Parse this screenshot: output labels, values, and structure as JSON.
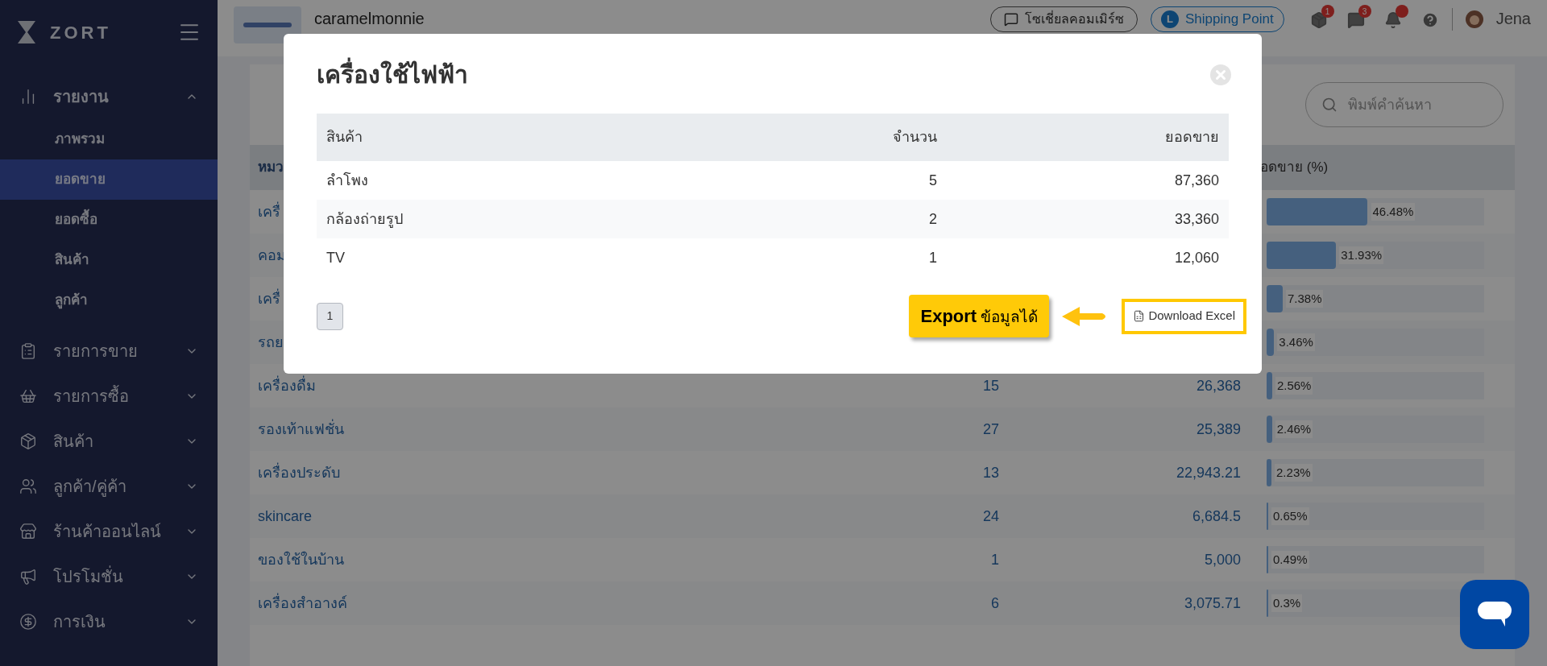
{
  "sidebar": {
    "logo": "ZORT",
    "items": [
      {
        "label": "รายงาน",
        "expanded": true,
        "children": [
          {
            "label": "ภาพรวม",
            "selected": false
          },
          {
            "label": "ยอดขาย",
            "selected": true
          },
          {
            "label": "ยอดซื้อ",
            "selected": false
          },
          {
            "label": "สินค้า",
            "selected": false
          },
          {
            "label": "ลูกค้า",
            "selected": false
          }
        ]
      },
      {
        "label": "รายการขาย",
        "expanded": false
      },
      {
        "label": "รายการซื้อ",
        "expanded": false
      },
      {
        "label": "สินค้า",
        "expanded": false
      },
      {
        "label": "ลูกค้า/คู่ค้า",
        "expanded": false
      },
      {
        "label": "ร้านค้าออนไลน์",
        "expanded": false
      },
      {
        "label": "โปรโมชั่น",
        "expanded": false
      },
      {
        "label": "การเงิน",
        "expanded": false
      }
    ]
  },
  "topbar": {
    "shop_name": "caramelmonnie",
    "buttons": [
      {
        "label": "โซเชี่ยลคอมเมิร์ซ",
        "kind": "social"
      },
      {
        "label": "Shipping Point",
        "kind": "shipping",
        "letter": "L"
      }
    ],
    "notifications": [
      {
        "alert": true,
        "badge": "1"
      },
      {
        "alert": true,
        "badge": "3"
      },
      {
        "alert": true
      }
    ],
    "user": "Jena"
  },
  "report": {
    "search": {
      "placeholder": "พิมพ์คำค้นหา"
    },
    "header": {
      "column_1": "หมว",
      "column_4": "อดขาย (%)"
    },
    "rows": [
      {
        "name": "เครื่",
        "pct": "46.48%",
        "level": 0.4648
      },
      {
        "name": "คอม",
        "pct": "31.93%",
        "level": 0.3193
      },
      {
        "name": "เครื่",
        "pct": "7.38%",
        "level": 0.0738
      },
      {
        "name": "รถย",
        "pct": "3.46%",
        "level": 0.0346
      },
      {
        "name": "เครื่องดื่ม",
        "qty": "15",
        "sales": "26,368",
        "pct": "2.56%",
        "level": 0.0256
      },
      {
        "name": "รองเท้าแฟชั่น",
        "qty": "27",
        "sales": "25,389",
        "pct": "2.46%",
        "level": 0.0246
      },
      {
        "name": "เครื่องประดับ",
        "qty": "13",
        "sales": "22,943.21",
        "pct": "2.23%",
        "level": 0.0223
      },
      {
        "name": "skincare",
        "qty": "24",
        "sales": "6,684.5",
        "pct": "0.65%",
        "level": 0.0065
      },
      {
        "name": "ของใช้ในบ้าน",
        "qty": "1",
        "sales": "5,000",
        "pct": "0.49%",
        "level": 0.0049
      },
      {
        "name": "เครื่องสำอางค์",
        "qty": "6",
        "sales": "3,075.71",
        "pct": "0.3%",
        "level": 0.003
      }
    ]
  },
  "modal": {
    "title": "เครื่องใช้ไฟฟ้า",
    "columns": [
      "สินค้า",
      "จำนวน",
      "ยอดขาย"
    ],
    "rows": [
      [
        "ลำโพง",
        "5",
        "87,360"
      ],
      [
        "กล้องถ่ายรูป",
        "2",
        "33,360"
      ],
      [
        "TV",
        "1",
        "12,060"
      ]
    ],
    "pages": [
      {
        "label": "1",
        "selected": true
      }
    ],
    "callout": "**Export** ข้อมูลได้",
    "download_button": "Download Excel"
  }
}
